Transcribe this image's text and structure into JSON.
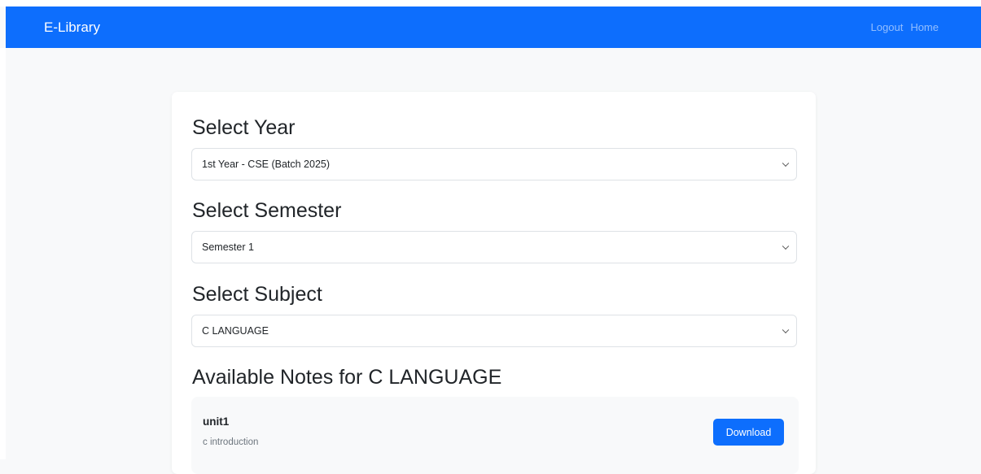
{
  "navbar": {
    "brand": "E-Library",
    "links": [
      "Logout",
      "Home"
    ]
  },
  "year": {
    "heading": "Select Year",
    "selected": "1st Year - CSE (Batch 2025)"
  },
  "semester": {
    "heading": "Select Semester",
    "selected": "Semester 1"
  },
  "subject": {
    "heading": "Select Subject",
    "selected": "C LANGUAGE"
  },
  "notes": {
    "heading": "Available Notes for C LANGUAGE",
    "items": [
      {
        "title": "unit1",
        "description": "c introduction",
        "button": "Download"
      }
    ]
  },
  "colors": {
    "primary": "#0d6efd",
    "background": "#f8f9fa"
  }
}
